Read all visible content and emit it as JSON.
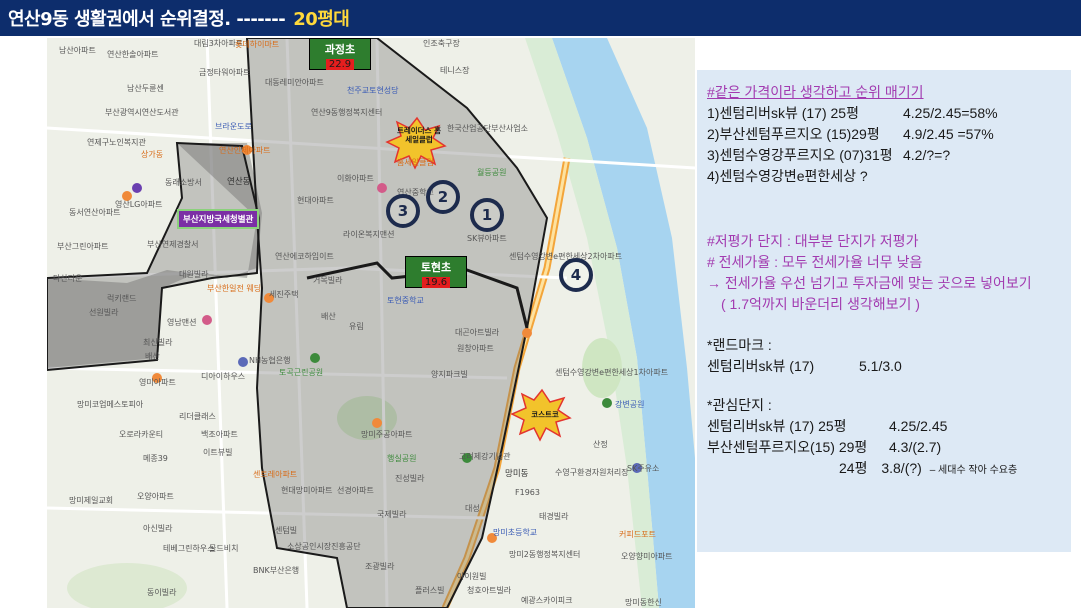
{
  "header": {
    "title": "연산9동 생활권에서 순위결정. -------",
    "highlight": "20평대"
  },
  "map": {
    "schools": [
      {
        "name": "과정초",
        "score": "22.9"
      },
      {
        "name": "토현초",
        "score": "19.6"
      }
    ],
    "ranks": [
      "1",
      "2",
      "3",
      "4"
    ],
    "office_label": "부산지방국세청별관",
    "burst_labels": [
      "트레이더스 홈세일클럽",
      "코스트코"
    ],
    "pois": [
      "남산아파트",
      "연산한솔아파트",
      "대림3차아파트",
      "롯데하이마트",
      "인조축구장",
      "금정타워아파트",
      "테니스장",
      "남산두륜센",
      "대동레미안아파트",
      "천주교토현성당",
      "부산광역시연산도서관",
      "브라운도로",
      "연산9동행정복지센터",
      "한국산업공단부산사업소",
      "연제구노인복지관",
      "상가동",
      "연산인제아파트",
      "홈세일클럽",
      "월등공원",
      "동래소방서",
      "연산동",
      "이화아파트",
      "영산LG아파트",
      "동서연산아파트",
      "현대아파트",
      "연산중학교",
      "부산연제경찰서",
      "라이온복지맨션",
      "SK뷰아파트",
      "부산그린아파트",
      "대원빌라",
      "연산에코하임이트",
      "센텀수영강변e편한세상2차아파트",
      "다산타운",
      "럭키랜드",
      "부산한일전 웨딩",
      "세진주택",
      "거목빌라",
      "토현중학교",
      "선원빌라",
      "영남맨션",
      "배산",
      "유림",
      "대곤아트빌라",
      "최신빌라",
      "NH농협은행",
      "원창아파트",
      "배산",
      "토곡근린공원",
      "양지파크빌",
      "디아이하우스",
      "센텀수영강변e편한세상1차아파트",
      "영미아파트",
      "망미코업메스토피아",
      "리더클래스",
      "강변공원",
      "오로라카운티",
      "백조아파트",
      "망미주공아파트",
      "산정",
      "메종39",
      "이트뷰빌",
      "행실공원",
      "고려제강기념관",
      "망미동",
      "수영구환경자원처리장",
      "SK주유소",
      "F1963",
      "진성빌라",
      "현대망미아파트",
      "센트레아파트",
      "망미제일교회",
      "오양아파트",
      "선경아파트",
      "대성",
      "국제빌라",
      "태경빌라",
      "아신빌라",
      "망미초등학교",
      "커피드포트",
      "테베그린하우스",
      "골드비치",
      "센텀빌",
      "소상공인시장진흥공단",
      "망미2동행정복지센터",
      "오양향미아파트",
      "BNK부산은행",
      "조광빌라",
      "아이원빌",
      "동이빌라",
      "플러스빌",
      "청호아트빌라",
      "예광스카이피크",
      "망미동한신"
    ]
  },
  "panel": {
    "section1": {
      "heading": "#같은 가격이라 생각하고 순위 매기기",
      "items": [
        {
          "label": "1)센텀리버sk뷰 (17) 25평",
          "value": "4.25/2.45=58%"
        },
        {
          "label": "2)부산센텀푸르지오 (15)29평",
          "value": "4.9/2.45 =57%"
        },
        {
          "label": "3)센텀수영강푸르지오 (07)31평",
          "value": "4.2/?=?"
        },
        {
          "label": "4)센텀수영강변e편한세상 ?",
          "value": ""
        }
      ]
    },
    "section2": {
      "line1": "#저평가 단지 : 대부분 단지가 저평가",
      "line2": "# 전세가율 : 모두 전세가율 너무 낮음",
      "line3": "→ 전세가율 우선 넘기고 투자금에 맞는 곳으로 넣어보기",
      "line4": "( 1.7억까지  바운더리 생각해보기 )"
    },
    "section3": {
      "heading": "*랜드마크 :",
      "label": "센텀리버sk뷰 (17)",
      "value": "5.1/3.0"
    },
    "section4": {
      "heading": "*관심단지 :",
      "row1_label": "센텀리버sk뷰 (17) 25평",
      "row1_value": "4.25/2.45",
      "row2_label": "부산센텀푸르지오(15) 29평",
      "row2_value": "4.3/(2.7)",
      "row3_label": "24평",
      "row3_value": "3.8/(?)",
      "row3_note": "– 세대수 작아 수요층"
    }
  }
}
